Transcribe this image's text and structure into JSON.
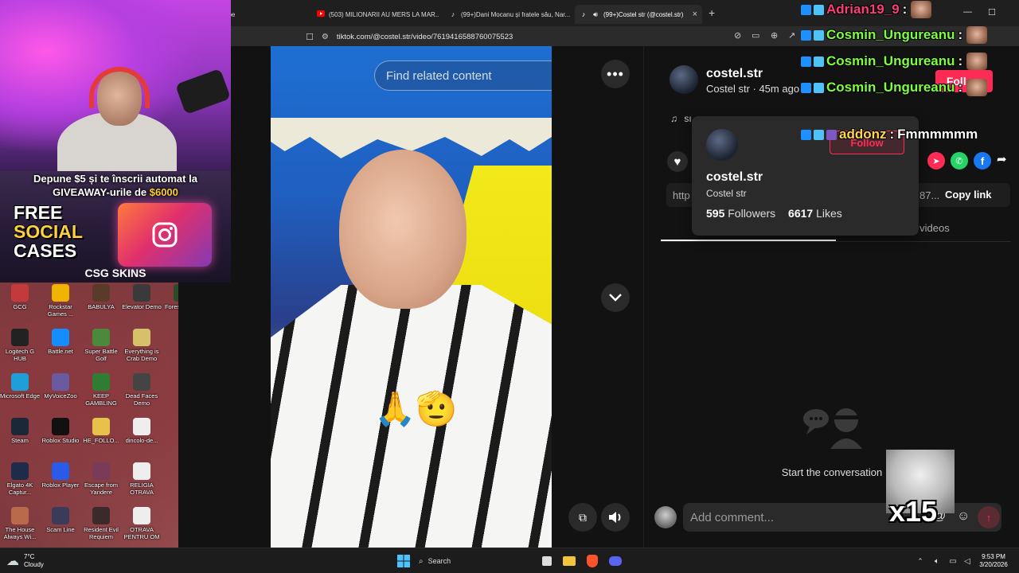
{
  "browser": {
    "tabs": [
      {
        "label": "ube",
        "icon": "youtube-icon",
        "active": false
      },
      {
        "label": "(503) MILIONARII AU MERS LA MAR...",
        "icon": "youtube-icon",
        "active": false
      },
      {
        "label": "(99+)Dani Mocanu și fratele său, Nar...",
        "icon": "tiktok-icon",
        "active": false
      },
      {
        "label": "(99+)Costel str (@costel.str) |",
        "icon": "tiktok-icon",
        "active": true
      }
    ],
    "url": "tiktok.com/@costel.str/video/7619416588760075523"
  },
  "video": {
    "search_placeholder": "Find related content"
  },
  "author": {
    "username": "costel.str",
    "nickname": "Costel str",
    "time_ago": "45m ago",
    "meta_line": "Costel str · 45m ago",
    "follow_label": "Follow",
    "music_text": "sı"
  },
  "profile_card": {
    "username": "costel.str",
    "nickname": "Costel str",
    "followers_count": "595",
    "followers_label": "Followers",
    "likes_count": "6617",
    "likes_label": "Likes",
    "follow_label": "Follow"
  },
  "share": {
    "link_prefix": "http",
    "link_suffix": "87...",
    "copy_link_label": "Copy link"
  },
  "tabs_panel": {
    "creator_videos_label": "or videos"
  },
  "comments": {
    "empty_label": "Start the conversation",
    "add_placeholder": "Add comment..."
  },
  "webcam_promo": {
    "line1": "Depune $5 și te înscrii automat la",
    "line2_prefix": "GIVEAWAY-urile de ",
    "line2_amount": "$6000",
    "big_line1": "FREE",
    "big_line2": "SOCIAL",
    "big_line3": "CASES",
    "brand": "CSG SKINS",
    "colors": {
      "amount": "#ffd02a",
      "social": "#ffd23a"
    }
  },
  "chat": [
    {
      "user": "Adrian19_9",
      "message": "",
      "color": "#ff3c7a"
    },
    {
      "user": "Cosmin_Ungureanu",
      "message": "",
      "color": "#7dff3c"
    },
    {
      "user": "Cosmin_Ungureanu",
      "message": "",
      "color": "#7dff3c"
    },
    {
      "user": "Cosmin_Ungureanu",
      "message": "",
      "color": "#7dff3c"
    },
    {
      "user": "addonz",
      "message": "Fmmmmmm",
      "color": "#ffd84a"
    }
  ],
  "gif_overlay": {
    "label": "x15"
  },
  "desktop": {
    "icons": [
      [
        {
          "label": "GCG",
          "icon": "gcg-icon",
          "color": "#c23a3a"
        },
        {
          "label": "Rockstar Games ...",
          "icon": "rockstar-icon",
          "color": "#f0b400"
        },
        {
          "label": "BABULYA",
          "icon": "game-icon",
          "color": "#5a3a2a"
        },
        {
          "label": "Elevator Demo",
          "icon": "game-icon",
          "color": "#3a3a3a"
        },
        {
          "label": "Forest Last T",
          "icon": "game-icon",
          "color": "#2a4a2a"
        }
      ],
      [
        {
          "label": "Logitech G HUB",
          "icon": "logitech-icon",
          "color": "#222"
        },
        {
          "label": "Battle.net",
          "icon": "battlenet-icon",
          "color": "#148eff"
        },
        {
          "label": "Super Battle Golf",
          "icon": "game-icon",
          "color": "#4a8a3a"
        },
        {
          "label": "Everything is Crab Demo",
          "icon": "game-icon",
          "color": "#d6c06a"
        }
      ],
      [
        {
          "label": "Microsoft Edge",
          "icon": "edge-icon",
          "color": "#1f9fd8"
        },
        {
          "label": "MyVoiceZoo",
          "icon": "app-icon",
          "color": "#6a5aa0"
        },
        {
          "label": "KEEP GAMBLING",
          "icon": "game-icon",
          "color": "#2e7d32"
        },
        {
          "label": "Dead Faces Demo",
          "icon": "game-icon",
          "color": "#444"
        }
      ],
      [
        {
          "label": "Steam",
          "icon": "steam-icon",
          "color": "#1b2838"
        },
        {
          "label": "Roblox Studio",
          "icon": "roblox-icon",
          "color": "#111"
        },
        {
          "label": "HE_FOLLO...",
          "icon": "folder-icon",
          "color": "#e6c24a"
        },
        {
          "label": "dincolo-de...",
          "icon": "file-icon",
          "color": "#eee"
        }
      ],
      [
        {
          "label": "Elgato 4K Captur...",
          "icon": "elgato-icon",
          "color": "#1f2b4a"
        },
        {
          "label": "Roblox Player",
          "icon": "roblox-icon",
          "color": "#2a5ae8"
        },
        {
          "label": "Escape from Yandere",
          "icon": "game-icon",
          "color": "#7a3a5a"
        },
        {
          "label": "RELIGIA OTRAVA",
          "icon": "file-icon",
          "color": "#eee"
        }
      ],
      [
        {
          "label": "The House Always Wi...",
          "icon": "game-icon",
          "color": "#b86a4a"
        },
        {
          "label": "Scam Line",
          "icon": "game-icon",
          "color": "#3a3a5a"
        },
        {
          "label": "Resident Evil Requiem",
          "icon": "game-icon",
          "color": "#3a2a2a"
        },
        {
          "label": "OTRAVA PENTRU OM",
          "icon": "file-icon",
          "color": "#eee"
        }
      ]
    ]
  },
  "taskbar": {
    "weather_temp": "7°C",
    "weather_desc": "Cloudy",
    "search_label": "Search",
    "time": "9:53 PM",
    "date": "3/20/2026"
  },
  "colors": {
    "tiktok_red": "#fe2c55",
    "panel_bg": "#121212",
    "card_bg": "#2a2a2a"
  }
}
